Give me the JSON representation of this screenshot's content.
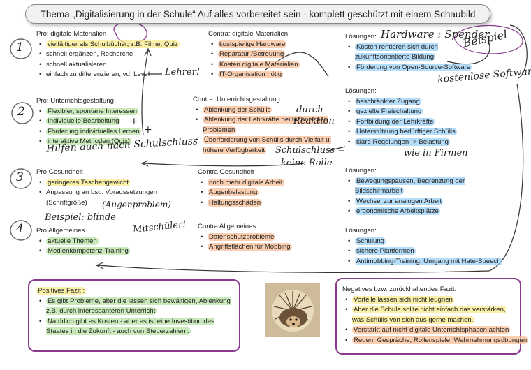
{
  "title": "Thema „Digitalisierung in der Schule“ Auf alles vorbereitet sein - komplett geschützt mit einem Schaubild",
  "numbers": [
    "1",
    "2",
    "3",
    "4"
  ],
  "pro_materials": {
    "heading": "Pro: digitale Materialien",
    "items": [
      "vielfältiger als Schulbücher, z.B. Filme, Quiz",
      "schnell ergänzen, Recherche",
      "schnell aktualisieren",
      "einfach zu differenzieren, vd. Level"
    ]
  },
  "contra_materials": {
    "heading": "Contra: digitale Materialien",
    "items": [
      "kostspielige Hardware",
      "Reparatur /Betreuung",
      "Kosten digitale Materialien",
      "IT-Organisation nötig"
    ]
  },
  "solutions_1": {
    "heading": "Lösungen:",
    "items": [
      "Kosten rentieren sich durch zukunftsorientierte Bildung",
      "Förderung von Open-Source-Software"
    ]
  },
  "pro_teaching": {
    "heading": "Pro: Unterrichtsgestaltung",
    "items": [
      "Flexibler, spontane Interessen",
      "Individuelle Bearbeitung",
      "Förderung individuelles Lernen",
      "interaktive Methoden (Quiz)"
    ]
  },
  "contra_teaching": {
    "heading": "Contra: Unterrichtsgestaltung",
    "items": [
      "Ablenkung der Schülis",
      "Ablenkung der Lehrkräfte bei technischen Problemen",
      "Überforderung von Schülis durch Vielfalt u. höhere Verfügbarkeit"
    ]
  },
  "solutions_2": {
    "heading": "Lösungen:",
    "items": [
      "beschränkter Zugang",
      "gezielte Freischaltung",
      "Fortbildung der Lehrkräfte",
      "Unterstützung bedürftiger Schülis",
      "klare Regelungen -> Belastung"
    ]
  },
  "pro_health": {
    "heading": "Pro Gesundheit",
    "items": [
      "geringeres Taschengewicht",
      "Anpassung an bsd. Voraussetzungen (Schriftgröße)"
    ]
  },
  "contra_health": {
    "heading": "Contra Gesundheit",
    "items": [
      "noch mehr digitale Arbeit",
      "Augenbelastung",
      "Haltungsschäden"
    ]
  },
  "solutions_3": {
    "heading": "Lösungen:",
    "items": [
      "Bewegungspausen, Begrenzung der Bildschirmarbeit",
      "Wechsel zur analogen Arbeit",
      "ergonomische Arbeitsplätze"
    ]
  },
  "pro_general": {
    "heading": "Pro Allgemeines",
    "items": [
      "aktuelle Themen",
      "Medienkompetenz-Training"
    ]
  },
  "contra_general": {
    "heading": "Contra Allgemeines",
    "items": [
      "Datenschutzprobleme",
      "Angriffsflächen für Mobbing"
    ]
  },
  "solutions_4": {
    "heading": "Lösungen:",
    "items": [
      "Schulung",
      "sichere Plattformen",
      "Antimobbing-Training, Umgang mit Hate-Speech"
    ]
  },
  "positive_fazit": {
    "heading": "Positives Fazit :",
    "items": [
      "Es gibt Probleme, aber die lassen sich bewältigen, Ablenkung z.B. durch interessanteren Unterricht",
      "Natürlich gibt es Kosten - aber es ist eine Investition des Staates in die Zukunft - auch von Steuerzahlern."
    ]
  },
  "negative_fazit": {
    "heading": "Negatives bzw. zurückhaltendes Fazit:",
    "items": [
      "Vorteile lassen sich nicht leugnen",
      "Aber die Schule sollte nicht einfach das verstärken, was Schülis von sich aus gerne machen.",
      "Verstärkt auf nicht-digitale Unterrichtsphasen achten",
      "Reden, Gespräche, Rollenspiele, Wahrnehmungsübungen"
    ]
  },
  "handwriting": {
    "hardware": "Hardware : Spender",
    "beispiel": "Beispiel",
    "kostenlos": "kostenlose Software",
    "lehrer": "Lehrer!",
    "durch": "durch",
    "reaktion": "Reaktion",
    "schulschluss": "Schulschluss =",
    "keine_rolle": "keine Rolle",
    "wie_in_firmen": "wie in Firmen",
    "hilfen": "Hilfen auch nach Schulschluss",
    "augenproblem": "(Augenproblem)",
    "beispiel_blinde": "Beispiel: blinde",
    "mitschueler": "Mitschüler!",
    "plus1": "+",
    "plus2": "+"
  },
  "colors": {
    "ink": "#8a3b8f",
    "green": "#b4e1a0",
    "yellow": "#faeb8c",
    "orange": "#f8be96",
    "blue": "#96cdf5",
    "pink": "#f5bed7"
  }
}
